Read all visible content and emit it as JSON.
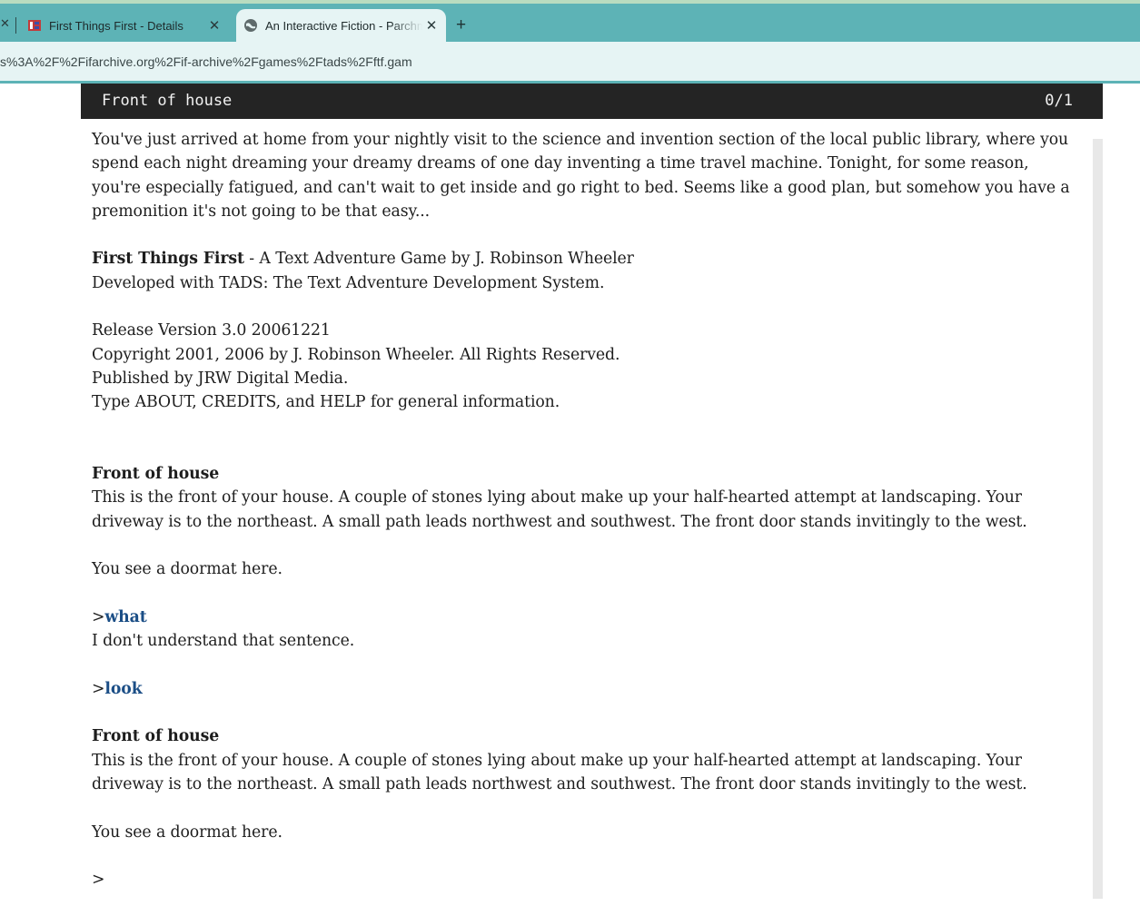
{
  "browser": {
    "tabs": [
      {
        "title": "First Things First - Details",
        "active": false
      },
      {
        "title": "An Interactive Fiction - Parchment",
        "active": true
      }
    ],
    "address": "s%3A%2F%2Fifarchive.org%2Fif-archive%2Fgames%2Ftads%2Fftf.gam"
  },
  "status": {
    "room": "Front of house",
    "score": "0/1"
  },
  "intro": "You've just arrived at home from your nightly visit to the science and invention section of the local public library, where you spend each night dreaming your dreamy dreams of one day inventing a time travel machine.  Tonight, for some reason, you're especially fatigued, and can't wait to get inside and go right to bed.  Seems like a good plan, but somehow you have a premonition it's not going to be that easy...",
  "game": {
    "title": "First Things First",
    "byline": " - A Text Adventure Game by J. Robinson Wheeler",
    "developed": "Developed with TADS:  The Text Adventure Development System.",
    "release": "Release Version 3.0 20061221",
    "copyright": "Copyright 2001, 2006 by J. Robinson Wheeler.  All Rights Reserved.",
    "publisher": "Published by JRW Digital Media.",
    "help": "Type ABOUT, CREDITS, and HELP for general information."
  },
  "room": {
    "name": "Front of house",
    "description": "This is the front of your house.  A couple of stones lying about make up your half-hearted attempt at landscaping.  Your driveway is to the northeast.  A small path leads northwest and southwest.  The front door stands invitingly to the west.",
    "objects": "You see a doormat here."
  },
  "commands": [
    {
      "prompt": ">",
      "text": "what",
      "response": "I don't understand that sentence."
    },
    {
      "prompt": ">",
      "text": "look"
    }
  ],
  "input_prompt": ">",
  "colors": {
    "chrome": "#5db3b6",
    "status_bg": "#242424",
    "command": "#1b4e86"
  }
}
